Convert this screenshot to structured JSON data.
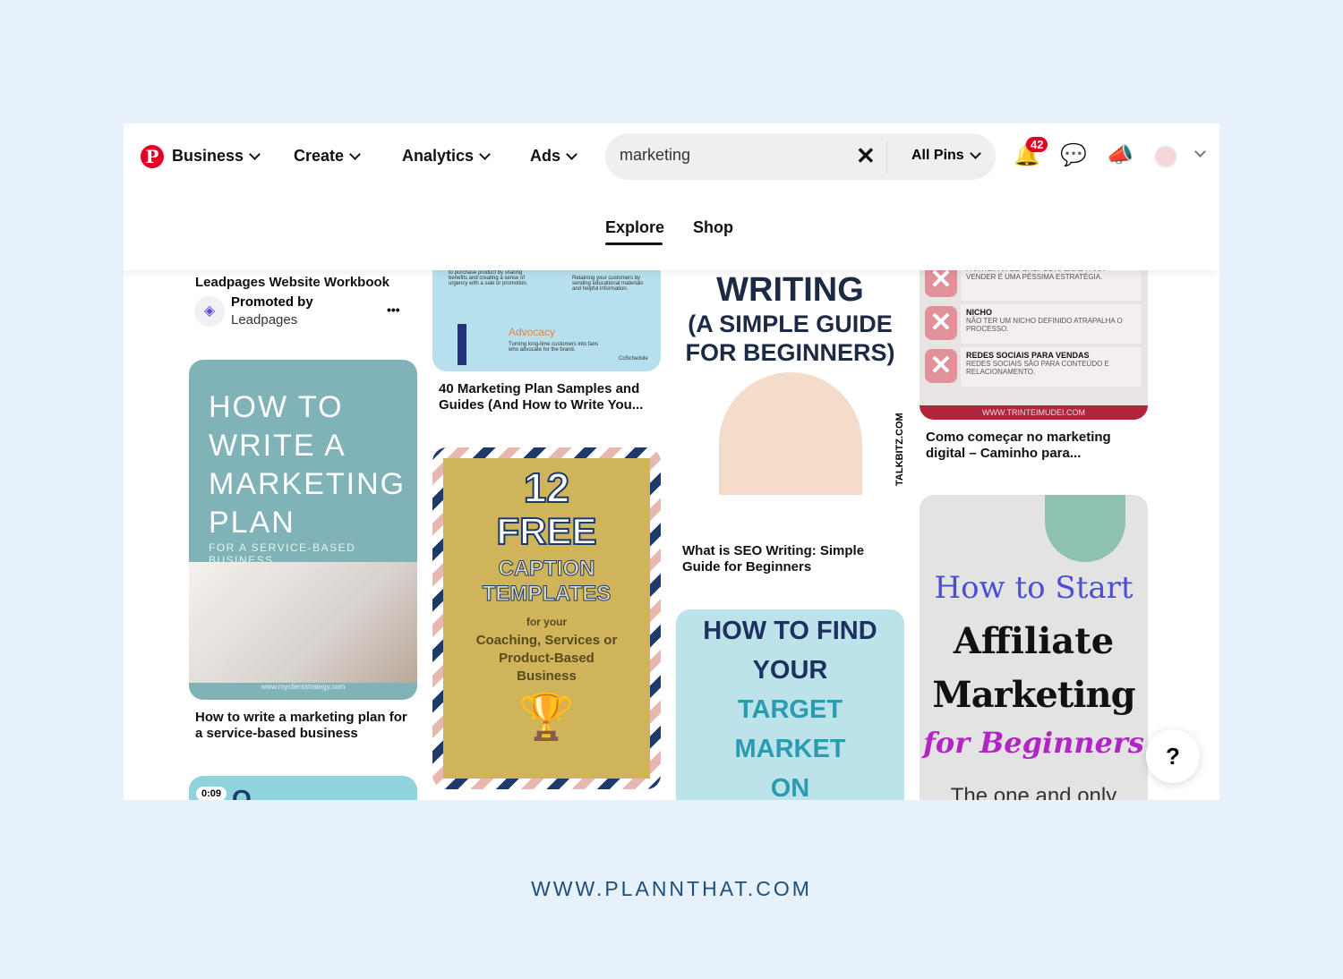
{
  "nav": {
    "logo": "P",
    "items": [
      "Business",
      "Create",
      "Analytics",
      "Ads"
    ]
  },
  "search": {
    "value": "marketing",
    "clear": "✕",
    "filter": "All Pins"
  },
  "notifications": {
    "count": "42"
  },
  "tabs": [
    "Explore",
    "Shop"
  ],
  "pins": {
    "promo": {
      "title": "Leadpages Website Workbook",
      "promoted": "Promoted by",
      "advertiser": "Leadpages",
      "more": "•••"
    },
    "p1": {
      "lines": [
        "HOW TO",
        "WRITE A",
        "MARKETING",
        "PLAN"
      ],
      "sub": "FOR A SERVICE-BASED BUSINESS",
      "url": "www.myclientstrategy.com",
      "caption": "How to write a marketing plan for a service-based business"
    },
    "p2": {
      "duration": "0:09",
      "text": "O PINTEREST"
    },
    "p3": {
      "left": "to purchase product by sharing benefits and creating a sense of urgency with a sale or promotion.",
      "right": "Retaining your customers by sending educational materials and helpful information.",
      "heading": "Advocacy",
      "desc": "Turning long-time customers into fans who advocate for the brand.",
      "brand": "CoSchedule",
      "caption": "40 Marketing Plan Samples and Guides (And How to Write You..."
    },
    "p4": {
      "num": "12",
      "free": "FREE",
      "l1": "CAPTION",
      "l2": "TEMPLATES",
      "for": "for your",
      "body": "Coaching, Services or Product-Based Business"
    },
    "p5": {
      "t1": "WRITING",
      "t2": "(A SIMPLE GUIDE",
      "t3": "FOR BEGINNERS)",
      "side": "TALKBITZ.COM",
      "caption": "What is SEO Writing: Simple Guide for Beginners"
    },
    "p6": {
      "lines": [
        "HOW TO FIND",
        "YOUR",
        "TARGET",
        "MARKET",
        "ON"
      ]
    },
    "p7": {
      "rows": [
        {
          "h": "",
          "t": "PARTICIPAR DE GRUPOS APENAS PARA VENDER É UMA PÉSSIMA ESTRATÉGIA."
        },
        {
          "h": "NICHO",
          "t": "NÃO TER UM NICHO DEFINIDO ATRAPALHA O PROCESSO."
        },
        {
          "h": "REDES SOCIAIS PARA VENDAS",
          "t": "REDES SOCIAIS SÃO PARA CONTEÚDO E RELACIONAMENTO."
        }
      ],
      "url": "WWW.TRINTEIMUDEI.COM",
      "caption": "Como começar no marketing digital – Caminho para..."
    },
    "p8": {
      "l1": "How to Start",
      "l2": "Affiliate",
      "l3": "Marketing",
      "l4": "for Beginners",
      "l5": "The one and only"
    }
  },
  "help": "?",
  "footer": "WWW.PLANNTHAT.COM",
  "colors": {
    "brand": "#e60023",
    "page_bg": "#e6f1fc",
    "footer": "#1d4e7c"
  }
}
